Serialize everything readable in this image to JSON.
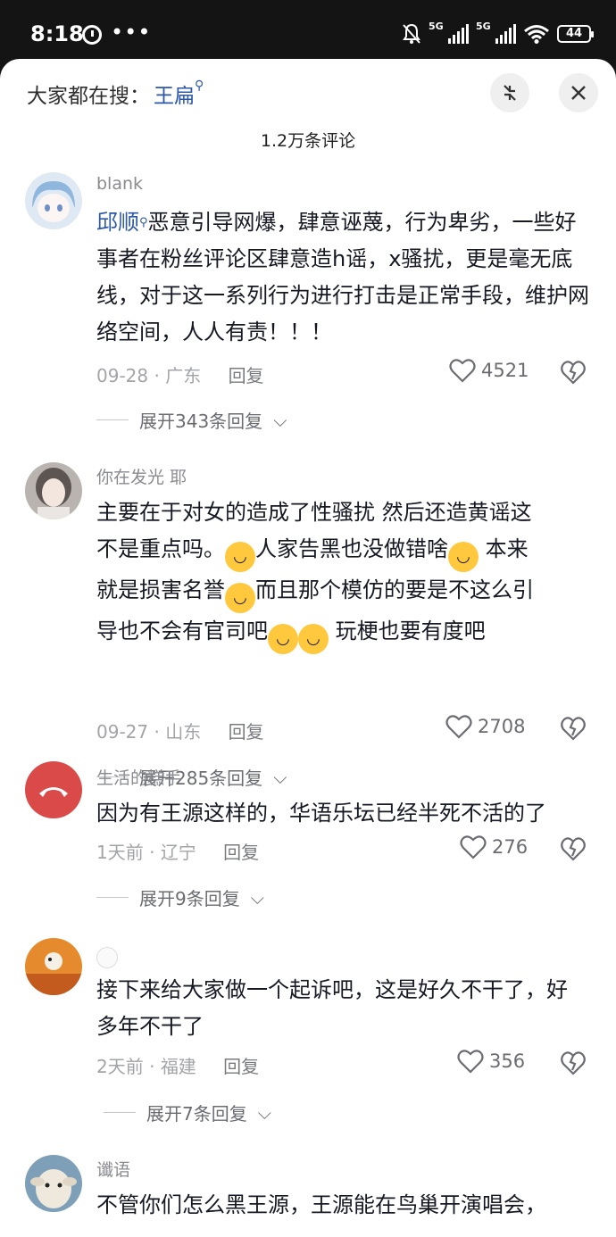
{
  "status_bar": {
    "time": "8:18",
    "dots": "•••",
    "battery": "44",
    "net1": "5G",
    "net2": "5G"
  },
  "header": {
    "search_prefix": "大家都在搜：",
    "search_keyword": "王扁",
    "comment_count": "1.2万条评论"
  },
  "comments": [
    {
      "username": "blank",
      "mention": "邱顺",
      "text": "恶意引导网爆，肆意诬蔑，行为卑劣，一些好事者在粉丝评论区肆意造h谣，x骚扰，更是毫无底线，对于这一系列行为进行打击是正常手段，维护网络空间，人人有责！！！",
      "date": "09-28",
      "location": "广东",
      "reply": "回复",
      "likes": "4521",
      "expand": "展开343条回复"
    },
    {
      "username": "你在发光 耶",
      "text_line1": "主要在于对女的造成了性骚扰 然后还造黄谣这",
      "text_line2a": "不是重点吗。",
      "text_line2b": "人家告黑也没做错啥",
      "text_line2c": " 本来",
      "text_line3a": "就是损害名誉",
      "text_line3b": "而且那个模仿的要是不这么引",
      "text_line4a": "导也不会有官司吧",
      "text_line4b": " 玩梗也要有度吧",
      "date": "09-27",
      "location": "山东",
      "reply": "回复",
      "likes": "2708",
      "expand": "展开285条回复"
    },
    {
      "username": "生活的糕手",
      "text": "因为有王源这样的，华语乐坛已经半死不活的了",
      "date": "1天前",
      "location": "辽宁",
      "reply": "回复",
      "likes": "276",
      "expand": "展开9条回复"
    },
    {
      "username": "",
      "text": "接下来给大家做一个起诉吧，这是好久不干了，好多年不干了",
      "date": "2天前",
      "location": "福建",
      "reply": "回复",
      "likes": "356",
      "expand": "展开7条回复"
    },
    {
      "username": "谶语",
      "text": "不管你们怎么黑王源，王源能在鸟巢开演唱会，"
    }
  ],
  "meta_separator": "·"
}
